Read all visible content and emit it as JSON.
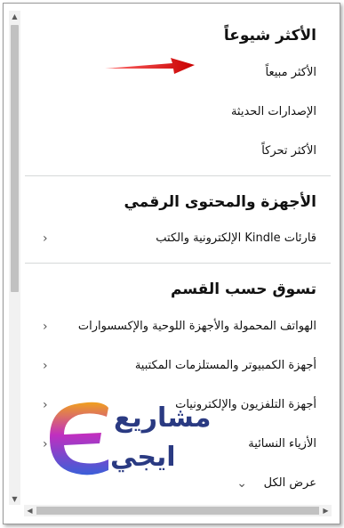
{
  "sections": [
    {
      "heading": "الأكثر شيوعاً",
      "items": [
        {
          "label": "الأكثر مبيعاً"
        },
        {
          "label": "الإصدارات الحديثة"
        },
        {
          "label": "الأكثر تحركاً"
        }
      ]
    },
    {
      "heading": "الأجهزة والمحتوى الرقمي",
      "items": [
        {
          "label": "قارئات Kindle الإلكترونية والكتب",
          "chevron": "chevron-left-icon"
        }
      ]
    },
    {
      "heading": "تسوق حسب القسم",
      "items": [
        {
          "label": "الهواتف المحمولة والأجهزة اللوحية والإكسسوارات",
          "chevron": "chevron-left-icon"
        },
        {
          "label": "أجهزة الكمبيوتر والمستلزمات المكتبية",
          "chevron": "chevron-left-icon"
        },
        {
          "label": "أجهزة التلفزيون والإلكترونيات",
          "chevron": "chevron-left-icon"
        },
        {
          "label": "الأزياء النسائية",
          "chevron": "chevron-left-icon"
        }
      ],
      "show_all": {
        "label": "عرض الكل",
        "chevron": "chevron-down-icon"
      }
    }
  ],
  "annotation": {
    "arrow_color": "#e01b1b",
    "arrow_icon": "red-arrow-icon"
  },
  "watermark": {
    "line1": "مشاريع",
    "line2": "ايجي",
    "colors": [
      "#f0a01e",
      "#c02fc0",
      "#3a5fd8",
      "#2a3a82"
    ]
  },
  "colors": {
    "text": "#111111",
    "divider": "#d5d9d9",
    "scrollbar_track": "#f1f1f1",
    "scrollbar_thumb": "#c1c1c1"
  }
}
